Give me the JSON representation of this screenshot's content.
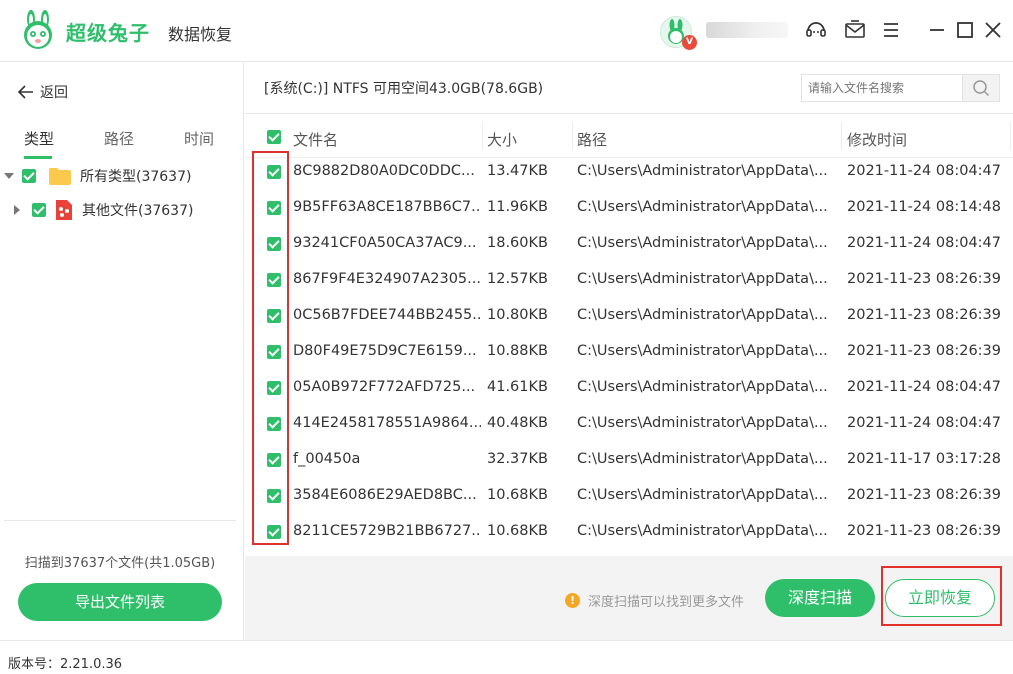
{
  "app": {
    "brand": "超级兔子",
    "product": "数据恢复",
    "vip_badge": "V"
  },
  "nav": {
    "back_label": "返回",
    "tabs": [
      {
        "label": "类型",
        "active": true
      },
      {
        "label": "路径",
        "active": false
      },
      {
        "label": "时间",
        "active": false
      }
    ]
  },
  "tree": {
    "items": [
      {
        "label": "所有类型(37637)",
        "icon": "folder-icon",
        "checked": true,
        "expanded": true
      },
      {
        "label": "其他文件(37637)",
        "icon": "other-file-icon",
        "checked": true,
        "expanded": false
      }
    ]
  },
  "scan_summary": "扫描到37637个文件(共1.05GB)",
  "export_label": "导出文件列表",
  "drive": {
    "info": "[系统(C:)] NTFS 可用空间43.0GB(78.6GB)",
    "search_placeholder": "请输入文件名搜索"
  },
  "table": {
    "columns": [
      "文件名",
      "大小",
      "路径",
      "修改时间"
    ],
    "rows": [
      {
        "name": "8C9882D80A0DC0DDC...",
        "size": "13.47KB",
        "path": "C:\\Users\\Administrator\\AppData\\...",
        "mtime": "2021-11-24 08:04:47",
        "checked": true
      },
      {
        "name": "9B5FF63A8CE187BB6C7...",
        "size": "11.96KB",
        "path": "C:\\Users\\Administrator\\AppData\\...",
        "mtime": "2021-11-24 08:14:48",
        "checked": true
      },
      {
        "name": "93241CF0A50CA37AC9...",
        "size": "18.60KB",
        "path": "C:\\Users\\Administrator\\AppData\\...",
        "mtime": "2021-11-24 08:04:47",
        "checked": true
      },
      {
        "name": "867F9F4E324907A2305...",
        "size": "12.57KB",
        "path": "C:\\Users\\Administrator\\AppData\\...",
        "mtime": "2021-11-23 08:26:39",
        "checked": true
      },
      {
        "name": "0C56B7FDEE744BB2455...",
        "size": "10.80KB",
        "path": "C:\\Users\\Administrator\\AppData\\...",
        "mtime": "2021-11-23 08:26:39",
        "checked": true
      },
      {
        "name": "D80F49E75D9C7E6159...",
        "size": "10.88KB",
        "path": "C:\\Users\\Administrator\\AppData\\...",
        "mtime": "2021-11-23 08:26:39",
        "checked": true
      },
      {
        "name": "05A0B972F772AFD725...",
        "size": "41.61KB",
        "path": "C:\\Users\\Administrator\\AppData\\...",
        "mtime": "2021-11-24 08:04:47",
        "checked": true
      },
      {
        "name": "414E2458178551A9864...",
        "size": "40.48KB",
        "path": "C:\\Users\\Administrator\\AppData\\...",
        "mtime": "2021-11-24 08:04:47",
        "checked": true
      },
      {
        "name": "f_00450a",
        "size": "32.37KB",
        "path": "C:\\Users\\Administrator\\AppData\\...",
        "mtime": "2021-11-17 03:17:28",
        "checked": true
      },
      {
        "name": "3584E6086E29AED8BC...",
        "size": "10.68KB",
        "path": "C:\\Users\\Administrator\\AppData\\...",
        "mtime": "2021-11-23 08:26:39",
        "checked": true
      },
      {
        "name": "8211CE5729B21BB6727...",
        "size": "10.68KB",
        "path": "C:\\Users\\Administrator\\AppData\\...",
        "mtime": "2021-11-23 08:26:39",
        "checked": true
      }
    ]
  },
  "footer": {
    "tip": "深度扫描可以找到更多文件",
    "deep_scan_label": "深度扫描",
    "recover_label": "立即恢复"
  },
  "version": "版本号：2.21.0.36",
  "colors": {
    "accent": "#2fbf6b",
    "highlight": "#e0312c",
    "warning": "#f5a623"
  }
}
